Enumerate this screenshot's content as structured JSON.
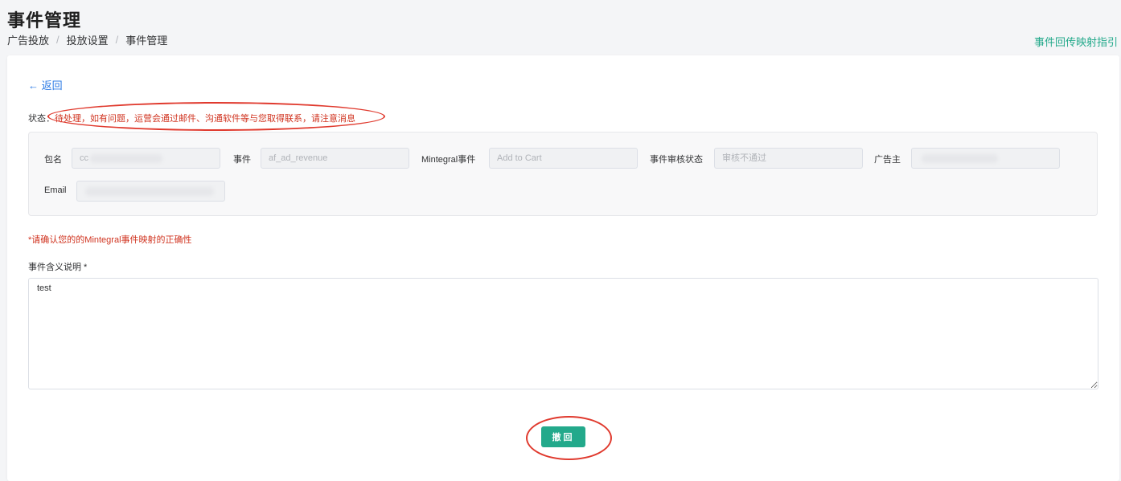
{
  "header": {
    "title": "事件管理",
    "breadcrumb": [
      "广告投放",
      "投放设置",
      "事件管理"
    ],
    "guide_link": "事件回传映射指引"
  },
  "main": {
    "back_label": "← 返回",
    "status_label": "状态：",
    "status_text": "待处理，如有问题，运营会通过邮件、沟通软件等与您取得联系，请注意消息",
    "fields": {
      "package": {
        "label": "包名",
        "value": "cc"
      },
      "event": {
        "label": "事件",
        "value": "af_ad_revenue"
      },
      "mintegral_event": {
        "label": "Mintegral事件",
        "value": "Add to Cart"
      },
      "review_status": {
        "label": "事件审核状态",
        "value": "审核不通过"
      },
      "advertiser": {
        "label": "广告主",
        "value": ""
      },
      "email": {
        "label": "Email",
        "value": ""
      }
    },
    "warning": "*请确认您的的Mintegral事件映射的正确性",
    "description_label": "事件含义说明 *",
    "description_value": "test",
    "revoke_button": "撤回"
  },
  "colors": {
    "accent": "#23a98b",
    "link": "#2d7be5",
    "warning": "#d0331f",
    "annotation": "#e03a2e"
  }
}
